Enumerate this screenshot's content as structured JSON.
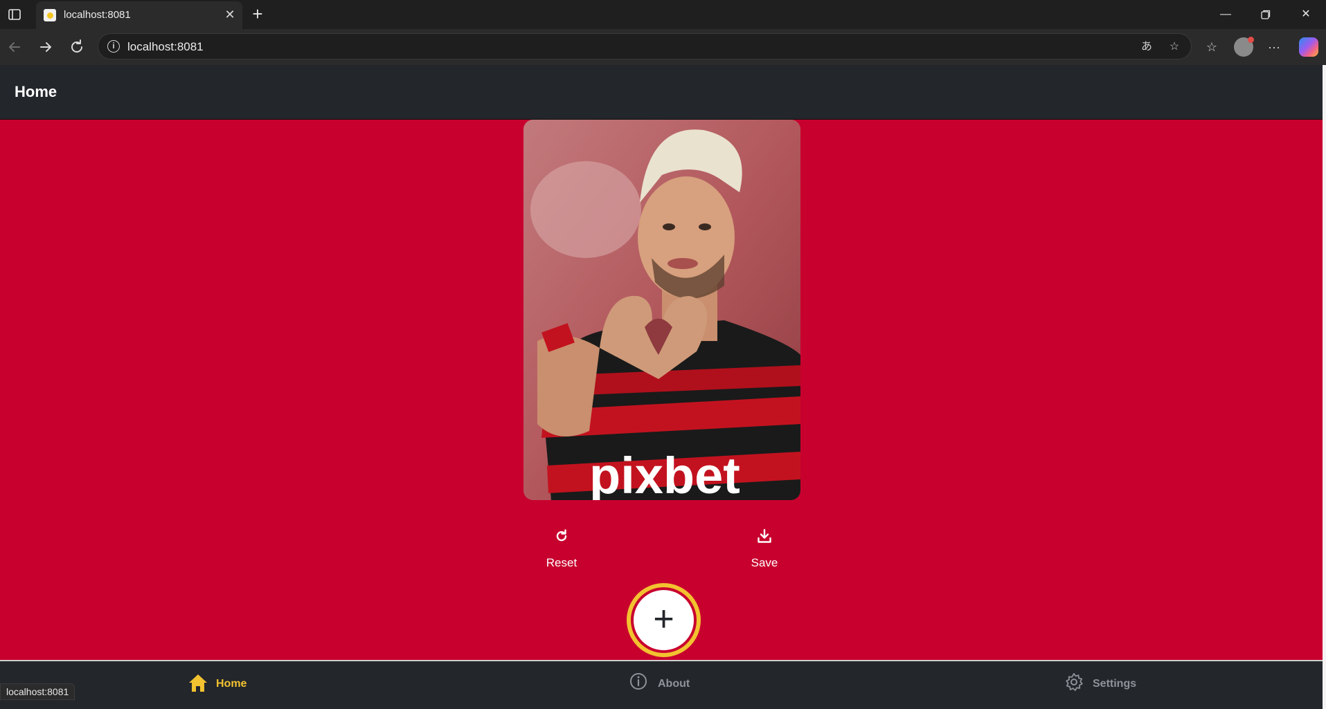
{
  "browser": {
    "tab_title": "localhost:8081",
    "address": "localhost:8081",
    "status_url": "localhost:8081"
  },
  "app": {
    "header_title": "Home",
    "accent_color": "#f2c230",
    "background_color": "#c8002e"
  },
  "actions": {
    "reset_label": "Reset",
    "add_label": "+",
    "save_label": "Save"
  },
  "bottom_nav": {
    "items": [
      {
        "label": "Home",
        "icon": "home-icon",
        "active": true
      },
      {
        "label": "About",
        "icon": "info-icon",
        "active": false
      },
      {
        "label": "Settings",
        "icon": "gear-icon",
        "active": false
      }
    ]
  },
  "photo": {
    "shirt_text": "pixbet"
  }
}
